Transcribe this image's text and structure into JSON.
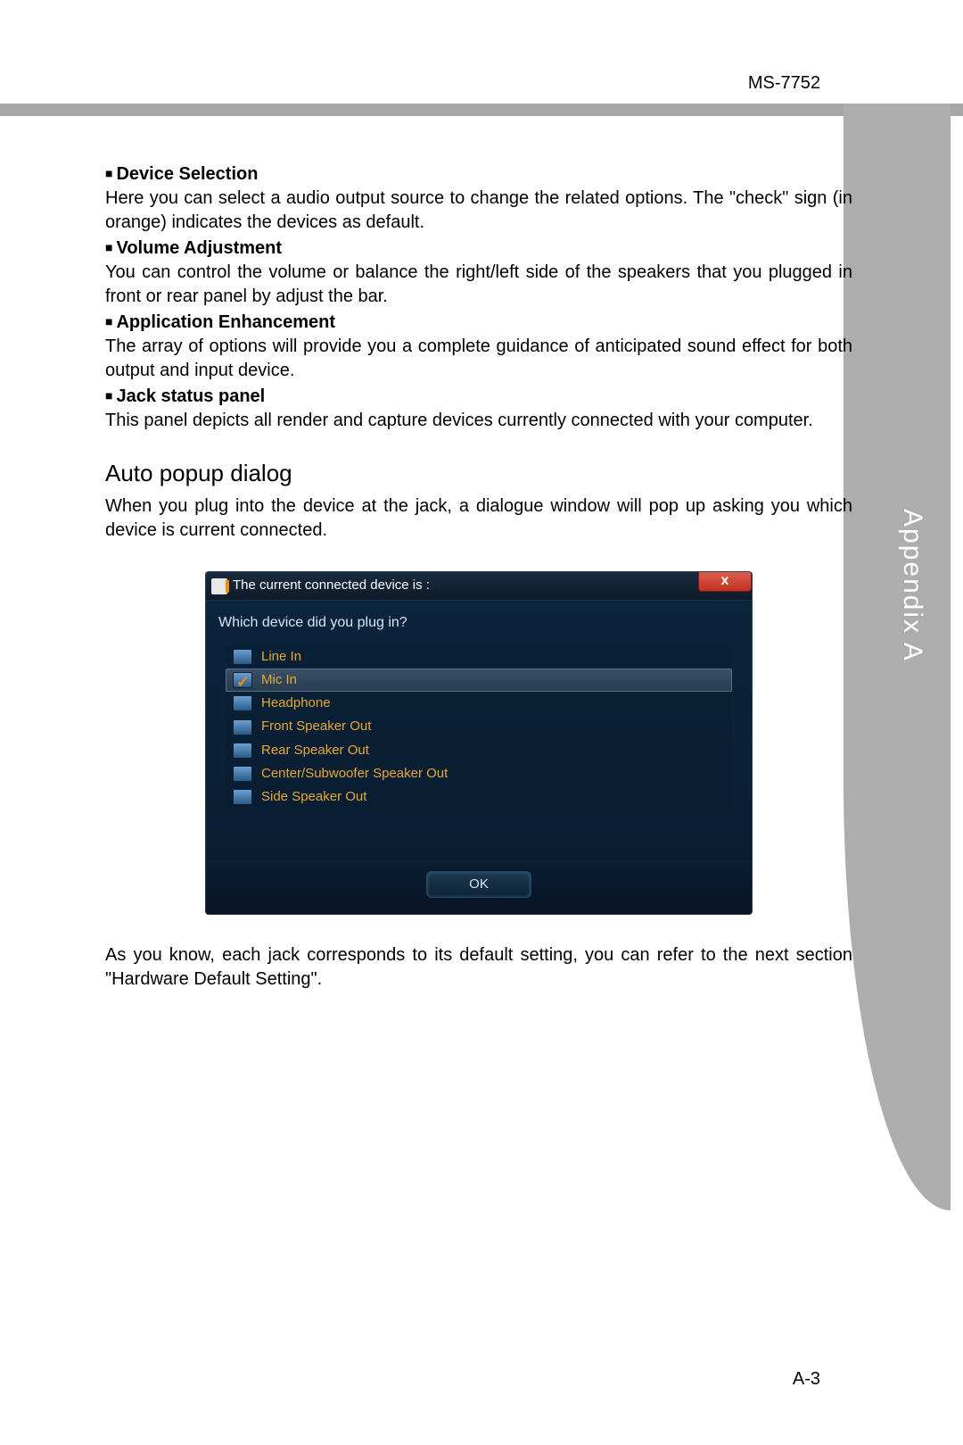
{
  "header": {
    "model": "MS-7752"
  },
  "tab": {
    "label": "Appendix A"
  },
  "sections": {
    "s1": {
      "title": "Device Selection",
      "body": "Here you can select a audio output source to change the related options. The \"check\" sign (in orange) indicates the devices as default."
    },
    "s2": {
      "title": "Volume Adjustment",
      "body": "You can control the volume or balance the right/left side of the speakers that you plugged in front or rear panel by adjust the bar."
    },
    "s3": {
      "title": "Application Enhancement",
      "body": "The array of options will provide you a complete guidance of anticipated sound effect for both output and input device."
    },
    "s4": {
      "title": "Jack status panel",
      "body": "This panel depicts all render and capture devices currently connected with your computer."
    }
  },
  "auto_popup": {
    "title": "Auto popup dialog",
    "body": "When you plug into the device at the jack, a dialogue window will pop up asking you which device is current connected."
  },
  "dialog": {
    "title": "The current connected device is :",
    "close": "x",
    "question": "Which device did you plug in?",
    "items": {
      "i0": {
        "label": "Line In",
        "selected": false,
        "checked": false
      },
      "i1": {
        "label": "Mic In",
        "selected": true,
        "checked": true
      },
      "i2": {
        "label": "Headphone",
        "selected": false,
        "checked": false
      },
      "i3": {
        "label": "Front Speaker Out",
        "selected": false,
        "checked": false
      },
      "i4": {
        "label": "Rear Speaker Out",
        "selected": false,
        "checked": false
      },
      "i5": {
        "label": "Center/Subwoofer Speaker Out",
        "selected": false,
        "checked": false
      },
      "i6": {
        "label": "Side Speaker Out",
        "selected": false,
        "checked": false
      }
    },
    "ok": "OK"
  },
  "footer_text": "As you know, each jack corresponds to its default setting, you can refer to the next section \"Hardware Default Setting\".",
  "page_number": "A-3"
}
